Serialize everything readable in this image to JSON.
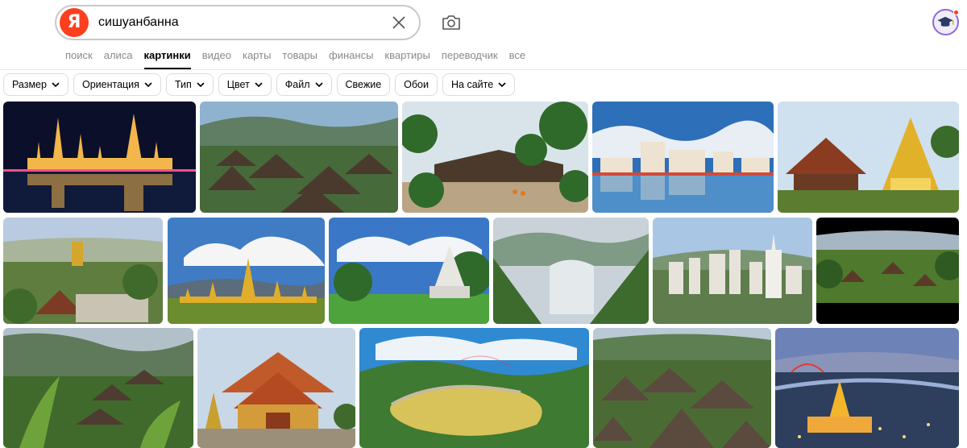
{
  "search": {
    "query": "сишуанбанна"
  },
  "services": [
    "поиск",
    "алиса",
    "картинки",
    "видео",
    "карты",
    "товары",
    "финансы",
    "квартиры",
    "переводчик",
    "все"
  ],
  "active_service": "картинки",
  "filters": [
    {
      "label": "Размер",
      "dropdown": true
    },
    {
      "label": "Ориентация",
      "dropdown": true
    },
    {
      "label": "Тип",
      "dropdown": true
    },
    {
      "label": "Цвет",
      "dropdown": true
    },
    {
      "label": "Файл",
      "dropdown": true
    },
    {
      "label": "Свежие",
      "dropdown": false
    },
    {
      "label": "Обои",
      "dropdown": false
    },
    {
      "label": "На сайте",
      "dropdown": true
    }
  ],
  "logo_letter": "Я",
  "colors": {
    "brand": "#fc3f1d",
    "text_muted": "#8a8a8a"
  },
  "icons": [
    "yandex-logo",
    "clear-icon",
    "camera-icon",
    "avatar",
    "chevron-down-icon"
  ]
}
